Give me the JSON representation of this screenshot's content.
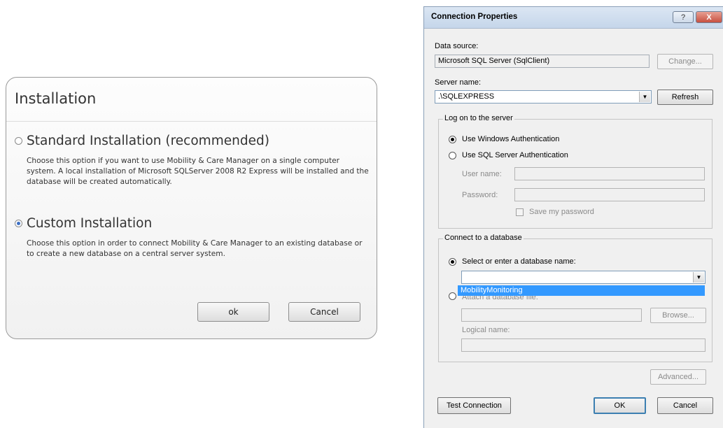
{
  "installation": {
    "title": "Installation",
    "options": [
      {
        "label": "Standard Installation (recommended)",
        "selected": false,
        "description": "Choose this option if you want to use Mobility & Care Manager on a single computer system. A local installation of Microsoft SQLServer 2008 R2 Express will be installed and the database will be created automatically."
      },
      {
        "label": "Custom Installation",
        "selected": true,
        "description": "Choose this option in order to connect Mobility & Care Manager to an existing database or to create a new database on a central server system."
      }
    ],
    "ok_label": "ok",
    "cancel_label": "Cancel"
  },
  "connection": {
    "title": "Connection Properties",
    "help_icon": "?",
    "close_icon": "X",
    "data_source_label": "Data source:",
    "data_source_value": "Microsoft SQL Server (SqlClient)",
    "change_label": "Change...",
    "server_name_label": "Server name:",
    "server_name_value": ".\\SQLEXPRESS",
    "refresh_label": "Refresh",
    "logon": {
      "group_label": "Log on to the server",
      "windows_auth": "Use Windows Authentication",
      "sql_auth": "Use SQL Server Authentication",
      "user_name_label": "User name:",
      "password_label": "Password:",
      "save_password": "Save my password"
    },
    "database": {
      "group_label": "Connect to a database",
      "select_label": "Select or enter a database name:",
      "dropdown_item": "MobilityMonitoring",
      "attach_label": "Attach a database file:",
      "browse_label": "Browse...",
      "logical_name_label": "Logical name:"
    },
    "advanced_label": "Advanced...",
    "test_label": "Test Connection",
    "ok_label": "OK",
    "cancel_label": "Cancel"
  }
}
